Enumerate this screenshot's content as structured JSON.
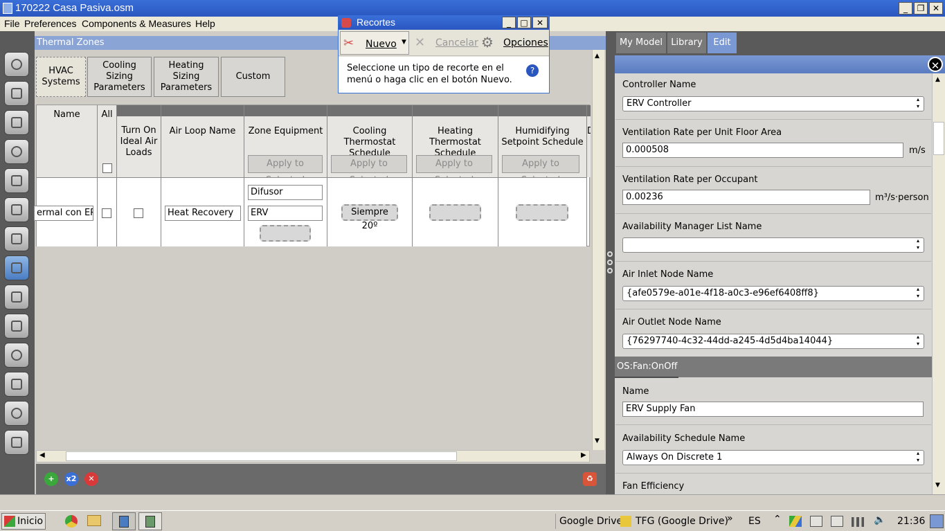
{
  "window": {
    "title": "170222 Casa Pasiva.osm"
  },
  "menu": [
    "File",
    "Preferences",
    "Components & Measures",
    "Help"
  ],
  "thermal_zones": {
    "header": "Thermal Zones",
    "tabs": [
      {
        "label": "HVAC Systems"
      },
      {
        "label": "Cooling Sizing Parameters"
      },
      {
        "label": "Heating Sizing Parameters"
      },
      {
        "label": "Custom"
      }
    ],
    "columns": {
      "name": "Name",
      "all": "All",
      "ideal": "Turn On Ideal Air Loads",
      "airloop": "Air Loop Name",
      "zone_equipment": "Zone Equipment",
      "cooling": "Cooling Thermostat Schedule",
      "heating": "Heating Thermostat Schedule",
      "humidifying": "Humidifying Setpoint Schedule",
      "extra": "D"
    },
    "apply_label": "Apply to Selected",
    "row": {
      "name": "ermal con ERV",
      "airloop": "Heat Recovery",
      "equip1": "Difusor",
      "equip2": "ERV",
      "cooling": "Siempre 20º"
    }
  },
  "right_panel": {
    "tabs": [
      "My Model",
      "Library",
      "Edit"
    ],
    "fields": {
      "controller_name_label": "Controller Name",
      "controller_name": "ERV Controller",
      "vent_area_label": "Ventilation Rate per Unit Floor Area",
      "vent_area": "0.000508",
      "vent_area_unit": "m/s",
      "vent_occ_label": "Ventilation Rate per Occupant",
      "vent_occ": "0.00236",
      "vent_occ_unit": "m³/s·person",
      "avail_mgr_label": "Availability Manager List Name",
      "avail_mgr": "",
      "air_inlet_label": "Air Inlet Node Name",
      "air_inlet": "{afe0579e-a01e-4f18-a0c3-e96ef6408ff8}",
      "air_outlet_label": "Air Outlet Node Name",
      "air_outlet": "{76297740-4c32-44dd-a245-4d5d4ba14044}",
      "section": "OS:Fan:OnOff",
      "fan_name_label": "Name",
      "fan_name": "ERV Supply Fan",
      "avail_sched_label": "Availability Schedule Name",
      "avail_sched": "Always On Discrete 1",
      "fan_eff_label": "Fan Efficiency"
    }
  },
  "recortes": {
    "title": "Recortes",
    "nuevo": "Nuevo",
    "cancelar": "Cancelar",
    "opciones": "Opciones",
    "message": "Seleccione un tipo de recorte en el menú o haga clic en el botón Nuevo."
  },
  "taskbar": {
    "start": "Inicio",
    "google_drive": "Google Drive",
    "tfg": "TFG (Google Drive)",
    "lang": "ES",
    "time": "21:36"
  }
}
